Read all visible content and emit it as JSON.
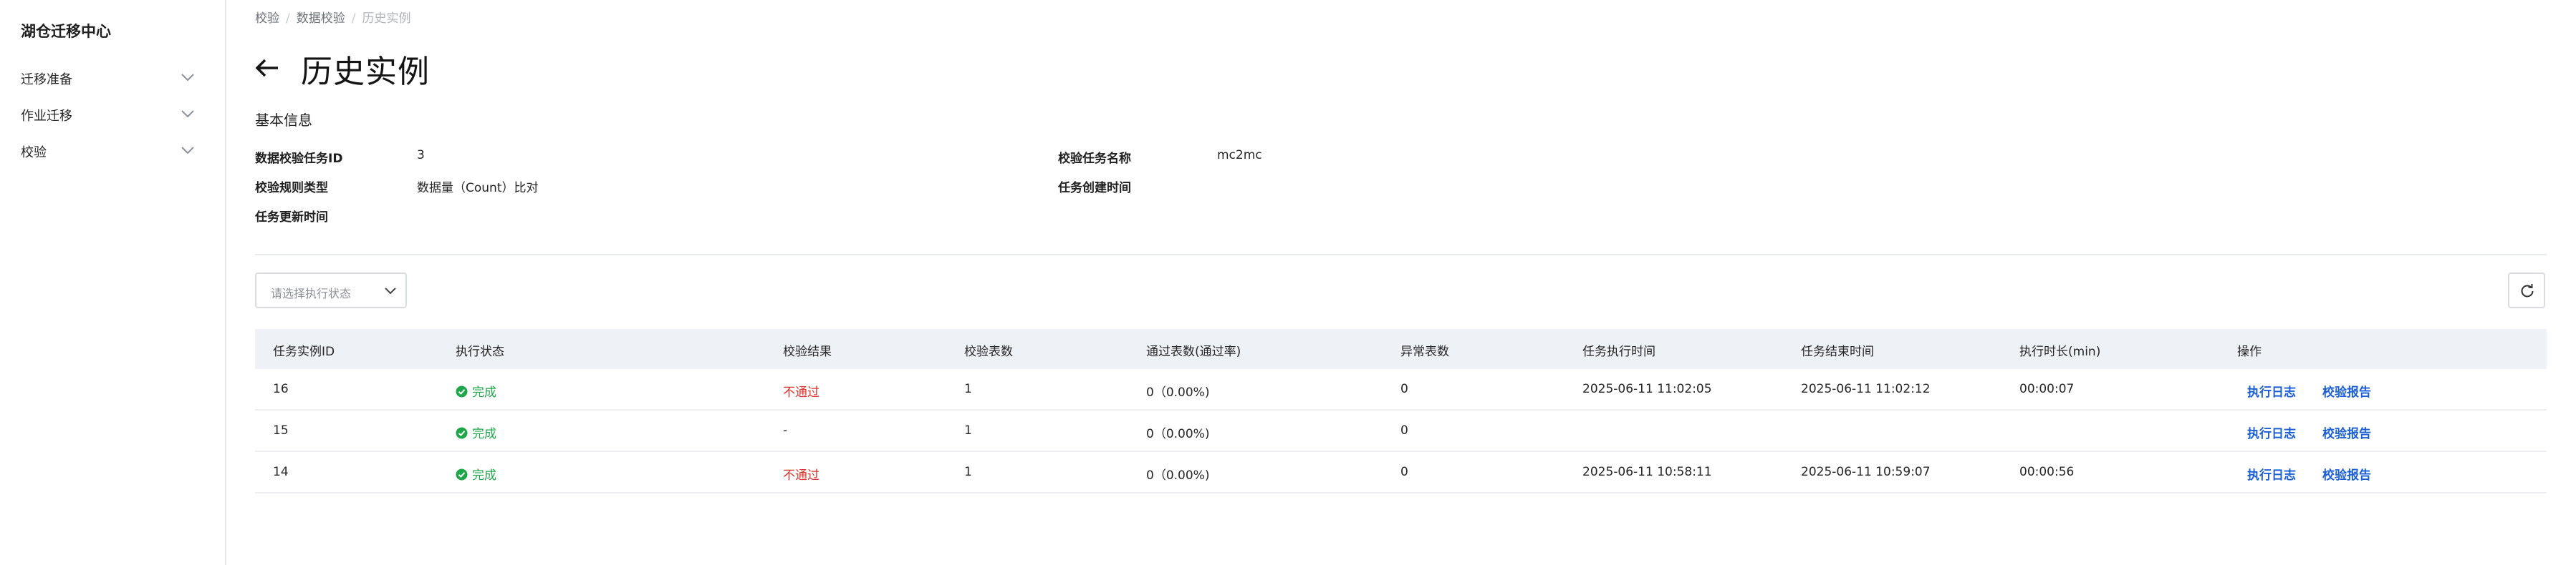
{
  "sidebar": {
    "title": "湖仓迁移中心",
    "items": [
      {
        "label": "迁移准备"
      },
      {
        "label": "作业迁移"
      },
      {
        "label": "校验"
      }
    ]
  },
  "breadcrumb": [
    "校验",
    "数据校验",
    "历史实例"
  ],
  "page_title": "历史实例",
  "section_title": "基本信息",
  "info": {
    "task_id_label": "数据校验任务ID",
    "task_id_value": "3",
    "task_name_label": "校验任务名称",
    "task_name_value": "mc2mc",
    "rule_type_label": "校验规则类型",
    "rule_type_value": "数据量（Count）比对",
    "created_label": "任务创建时间",
    "created_value": "",
    "updated_label": "任务更新时间",
    "updated_value": ""
  },
  "filter": {
    "status_placeholder": "请选择执行状态"
  },
  "table": {
    "headers": [
      "任务实例ID",
      "执行状态",
      "校验结果",
      "校验表数",
      "通过表数(通过率)",
      "异常表数",
      "任务执行时间",
      "任务结束时间",
      "执行时长(min)",
      "操作"
    ],
    "rows": [
      {
        "id": "16",
        "status": "完成",
        "result": "不通过",
        "tables": "1",
        "passed": "0（0.00%)",
        "abnormal": "0",
        "start": "2025-06-11 11:02:05",
        "end": "2025-06-11 11:02:12",
        "duration": "00:00:07",
        "action_log": "执行日志",
        "action_report": "校验报告"
      },
      {
        "id": "15",
        "status": "完成",
        "result": "-",
        "tables": "1",
        "passed": "0（0.00%)",
        "abnormal": "0",
        "start": "",
        "end": "",
        "duration": "",
        "action_log": "执行日志",
        "action_report": "校验报告"
      },
      {
        "id": "14",
        "status": "完成",
        "result": "不通过",
        "tables": "1",
        "passed": "0（0.00%)",
        "abnormal": "0",
        "start": "2025-06-11 10:58:11",
        "end": "2025-06-11 10:59:07",
        "duration": "00:00:56",
        "action_log": "执行日志",
        "action_report": "校验报告"
      }
    ]
  },
  "icons": {
    "back": "arrow-left-icon",
    "chevron": "chevron-down-icon",
    "refresh": "refresh-icon",
    "status_ok": "check-circle-icon"
  },
  "colors": {
    "success": "#1fa64a",
    "fail": "#e0312b",
    "link": "#1a5fd6",
    "table_header_bg": "#eef1f5"
  }
}
